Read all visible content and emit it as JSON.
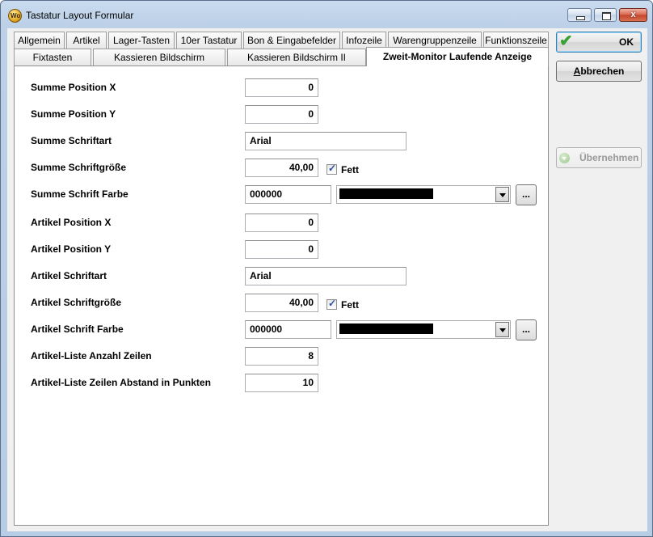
{
  "window": {
    "title": "Tastatur Layout Formular",
    "icon_text": "Wo"
  },
  "tabs": {
    "row1": [
      "Allgemein",
      "Artikel",
      "Lager-Tasten",
      "10er Tastatur",
      "Bon & Eingabefelder",
      "Infozeile",
      "Warengruppenzeile",
      "Funktionszeile"
    ],
    "row2": [
      "Fixtasten",
      "Kassieren Bildschirm",
      "Kassieren Bildschirm II",
      "Zweit-Monitor Laufende Anzeige"
    ],
    "active": "Zweit-Monitor Laufende Anzeige"
  },
  "form": {
    "summe_pos_x_label": "Summe Position X",
    "summe_pos_x": "0",
    "summe_pos_y_label": "Summe Position Y",
    "summe_pos_y": "0",
    "summe_font_label": "Summe Schriftart",
    "summe_font": "Arial",
    "summe_size_label": "Summe Schriftgröße",
    "summe_size": "40,00",
    "summe_bold_label": "Fett",
    "summe_bold": true,
    "summe_color_label": "Summe Schrift Farbe",
    "summe_color": "000000",
    "summe_color_hex": "#000000",
    "artikel_pos_x_label": "Artikel Position X",
    "artikel_pos_x": "0",
    "artikel_pos_y_label": "Artikel Position Y",
    "artikel_pos_y": "0",
    "artikel_font_label": "Artikel Schriftart",
    "artikel_font": "Arial",
    "artikel_size_label": "Artikel Schriftgröße",
    "artikel_size": "40,00",
    "artikel_bold_label": "Fett",
    "artikel_bold": true,
    "artikel_color_label": "Artikel Schrift Farbe",
    "artikel_color": "000000",
    "artikel_color_hex": "#000000",
    "list_rows_label": "Artikel-Liste Anzahl Zeilen",
    "list_rows": "8",
    "list_spacing_label": "Artikel-Liste Zeilen Abstand in Punkten",
    "list_spacing": "10",
    "browse_label": "..."
  },
  "buttons": {
    "ok": "OK",
    "cancel_prefix": "A",
    "cancel_rest": "bbrechen",
    "apply": "Übernehmen"
  },
  "window_controls": {
    "close_glyph": "x"
  }
}
